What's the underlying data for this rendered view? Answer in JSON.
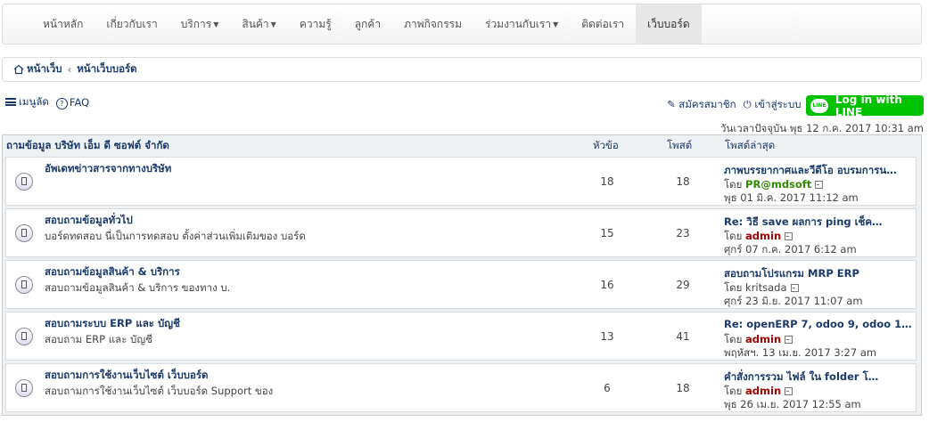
{
  "nav": {
    "items": [
      {
        "label": "หน้าหลัก",
        "dropdown": false
      },
      {
        "label": "เกี่ยวกับเรา",
        "dropdown": false
      },
      {
        "label": "บริการ",
        "dropdown": true
      },
      {
        "label": "สินค้า",
        "dropdown": true
      },
      {
        "label": "ความรู้",
        "dropdown": false
      },
      {
        "label": "ลูกค้า",
        "dropdown": false
      },
      {
        "label": "ภาพกิจกรรม",
        "dropdown": false
      },
      {
        "label": "ร่วมงานกับเรา",
        "dropdown": true
      },
      {
        "label": "ติดต่อเรา",
        "dropdown": false
      },
      {
        "label": "เว็บบอร์ด",
        "dropdown": false,
        "active": true
      }
    ]
  },
  "breadcrumb": {
    "home": "หน้าเว็บ",
    "current": "หน้าเว็บบอร์ด"
  },
  "quick": {
    "menu": "เมนูลัด",
    "faq": "FAQ"
  },
  "auth": {
    "register": "สมัครสมาชิก",
    "login": "เข้าสู่ระบบ",
    "line_login": "Log in with LINE",
    "line_logo": "LINE"
  },
  "current_time": "วันเวลาปัจจุบัน พุธ 12 ก.ค. 2017 10:31 am",
  "forum_header": {
    "forum": "ถามข้อมูล บริษัท เอ็ม ดี ซอฟต์ จำกัด",
    "topics": "หัวข้อ",
    "posts": "โพสต์",
    "last_post": "โพสต์ล่าสุด"
  },
  "colors": {
    "user_green": "#2e8b00",
    "user_red": "#aa0000",
    "user_plain": "#444444",
    "line": "#00c300"
  },
  "forums": [
    {
      "title": "อัพเดทข่าวสารจากทางบริษัท",
      "desc": "",
      "topics": "18",
      "posts": "18",
      "last_title": "ภาพบรรยากาศและวีดีโอ อบรมการน…",
      "by": "โดย",
      "user": "PR@mdsoft",
      "user_color": "green",
      "date": "พุธ 01 มิ.ค. 2017 11:12 am"
    },
    {
      "title": "สอบถามข้อมูลทั่วไป",
      "desc": "บอร์ดทดสอบ นี่เป็นการทดสอบ ตั้งค่าส่วนเพิ่มเติมของ บอร์ด",
      "topics": "15",
      "posts": "23",
      "last_title": "Re: วิธี save ผลการ ping เช็ค…",
      "by": "โดย",
      "user": "admin",
      "user_color": "red",
      "date": "ศุกร์ 07 ก.ค. 2017 6:12 am"
    },
    {
      "title": "สอบถามข้อมูลสินค้า & บริการ",
      "desc": "สอบถามข้อมูลสินค้า & บริการ ของทาง บ.",
      "topics": "16",
      "posts": "29",
      "last_title": "สอบถามโปรแกรม MRP ERP",
      "by": "โดย",
      "user": "kritsada",
      "user_color": "plain",
      "date": "ศุกร์ 23 มิ.ย. 2017 11:07 am"
    },
    {
      "title": "สอบถามระบบ ERP และ บัญชี",
      "desc": "สอบถาม ERP และ บัญชี",
      "topics": "13",
      "posts": "41",
      "last_title": "Re: openERP 7, odoo 9, odoo 1…",
      "by": "โดย",
      "user": "admin",
      "user_color": "red",
      "date": "พฤหัสฯ. 13 เม.ย. 2017 3:27 am"
    },
    {
      "title": "สอบถามการใช้งานเว็บไซต์ เว็บบอร์ด",
      "desc": "สอบถามการใช้งานเว็บไซต์ เว็บบอร์ด Support ของ",
      "topics": "6",
      "posts": "18",
      "last_title": "คำสั่งการรวม ไฟล์ ใน folder โ…",
      "by": "โดย",
      "user": "admin",
      "user_color": "red",
      "date": "พุธ 26 เม.ย. 2017 12:55 am"
    }
  ]
}
